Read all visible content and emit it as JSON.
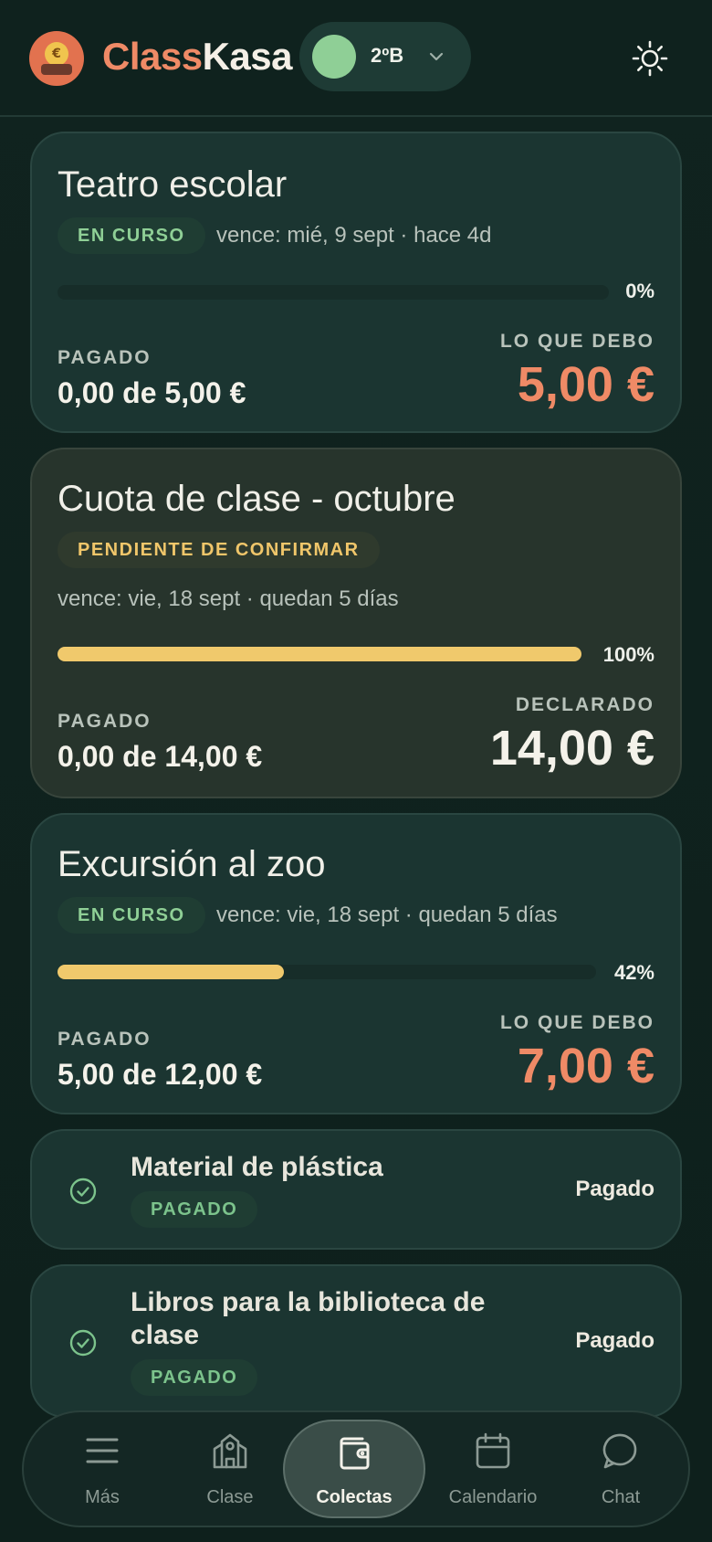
{
  "header": {
    "brand_part1": "Class",
    "brand_part2": "Kasa",
    "class_name": "2ºB",
    "logo_icon": "coin-euro-icon",
    "theme_icon": "sun-icon"
  },
  "colors": {
    "accent": "#ef8a66",
    "progress": "#f0c96c",
    "badge_green": "#8fcf96",
    "badge_yellow": "#f0c66a"
  },
  "collections": [
    {
      "title": "Teatro escolar",
      "badge": "EN CURSO",
      "due": "vence: mié, 9 sept · hace 4d",
      "progress_pct": 0,
      "progress_label": "0%",
      "paid_label": "PAGADO",
      "paid_value": "0,00 de 5,00 €",
      "right_label": "LO QUE DEBO",
      "right_amount": "5,00 €"
    },
    {
      "title": "Cuota de clase - octubre",
      "badge": "PENDIENTE DE CONFIRMAR",
      "due": "vence: vie, 18 sept · quedan 5 días",
      "progress_pct": 100,
      "progress_label": "100%",
      "paid_label": "PAGADO",
      "paid_value": "0,00 de 14,00 €",
      "right_label": "DECLARADO",
      "right_amount": "14,00 €"
    },
    {
      "title": "Excursión al zoo",
      "badge": "EN CURSO",
      "due": "vence: vie, 18 sept · quedan 5 días",
      "progress_pct": 42,
      "progress_label": "42%",
      "paid_label": "PAGADO",
      "paid_value": "5,00 de 12,00 €",
      "right_label": "LO QUE DEBO",
      "right_amount": "7,00 €"
    }
  ],
  "paid_items": [
    {
      "title": "Material de plástica",
      "badge": "PAGADO",
      "status": "Pagado",
      "icon": "check-circle-icon"
    },
    {
      "title": "Libros para la biblioteca de clase",
      "badge": "PAGADO",
      "status": "Pagado",
      "icon": "check-circle-icon"
    }
  ],
  "nav": [
    {
      "label": "Más",
      "icon": "menu-icon",
      "active": false
    },
    {
      "label": "Clase",
      "icon": "school-icon",
      "active": false
    },
    {
      "label": "Colectas",
      "icon": "wallet-icon",
      "active": true
    },
    {
      "label": "Calendario",
      "icon": "calendar-icon",
      "active": false
    },
    {
      "label": "Chat",
      "icon": "chat-bubble-icon",
      "active": false
    }
  ]
}
